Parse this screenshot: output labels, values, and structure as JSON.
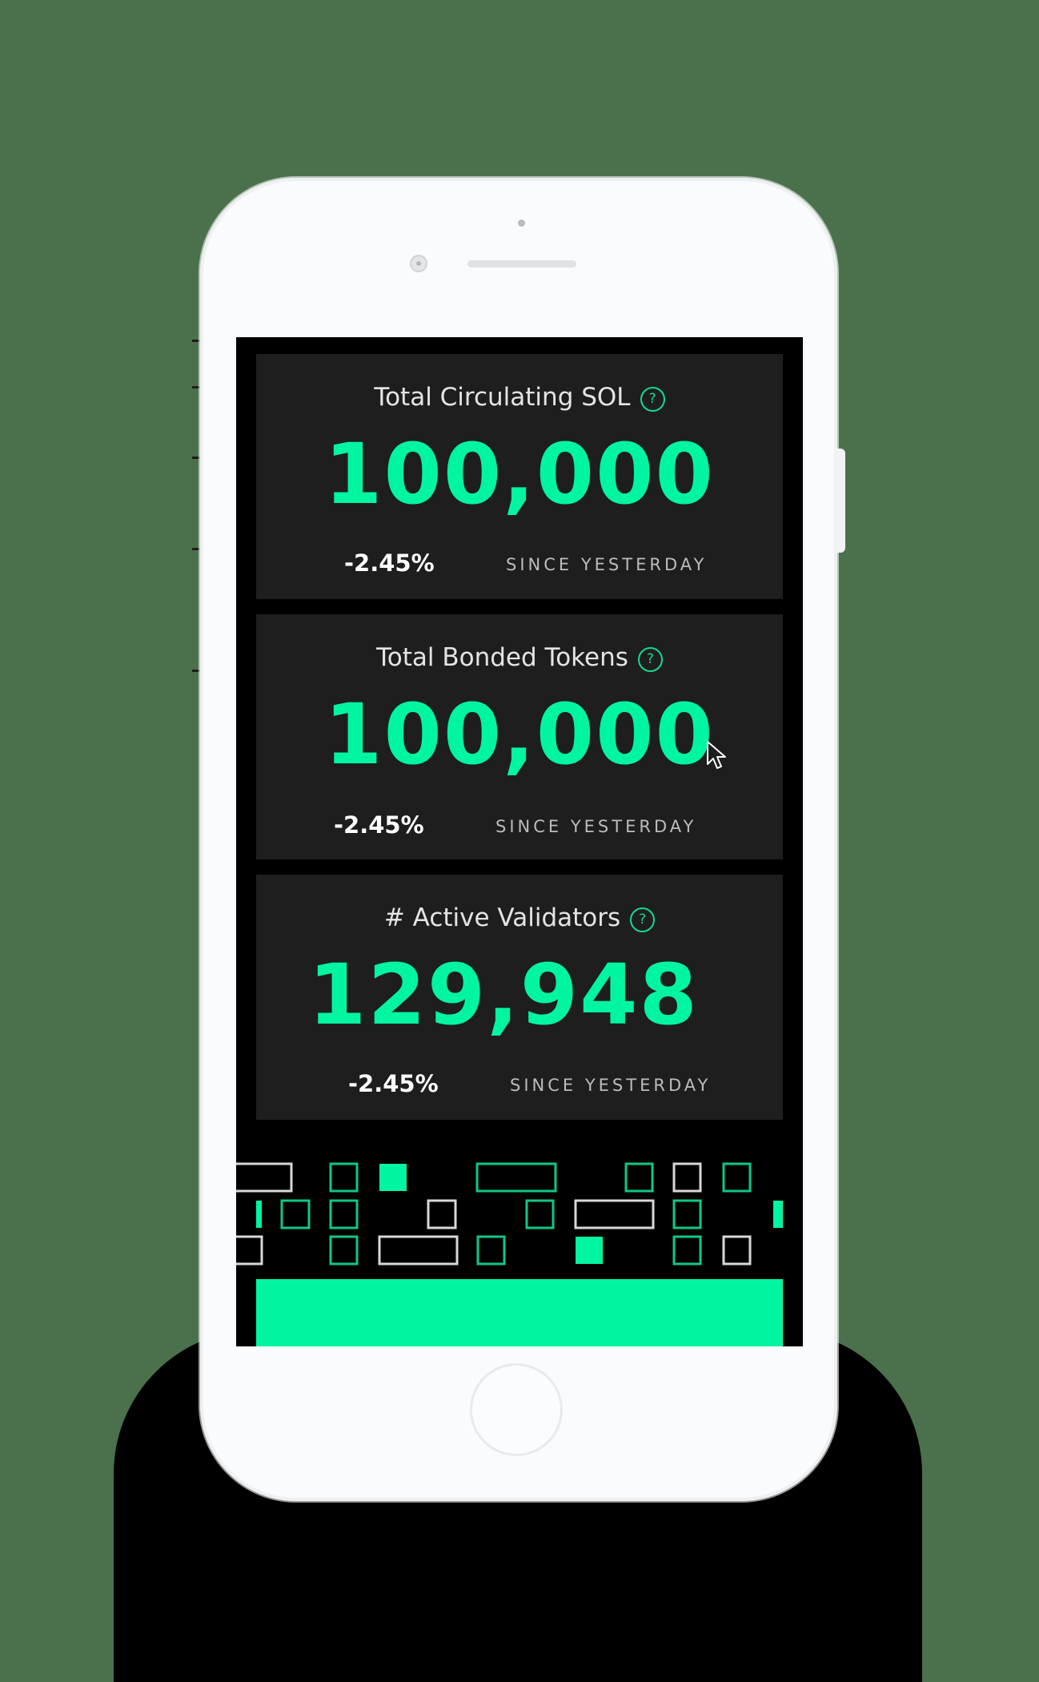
{
  "colors": {
    "accent": "#00f5a0",
    "card_background": "#1e1e1e",
    "screen_background": "#000000",
    "block_outline_white": "#d8d8d8",
    "block_outline_green": "#0fc784"
  },
  "icons": {
    "help": "?"
  },
  "stats": [
    {
      "title": "Total Circulating SOL",
      "value": "100,000",
      "change": "-2.45%",
      "since": "SINCE YESTERDAY"
    },
    {
      "title": "Total Bonded Tokens",
      "value": "100,000",
      "change": "-2.45%",
      "since": "SINCE YESTERDAY"
    },
    {
      "title": "# Active Validators",
      "value": "129,948",
      "change": "-2.45%",
      "since": "SINCE YESTERDAY"
    }
  ]
}
